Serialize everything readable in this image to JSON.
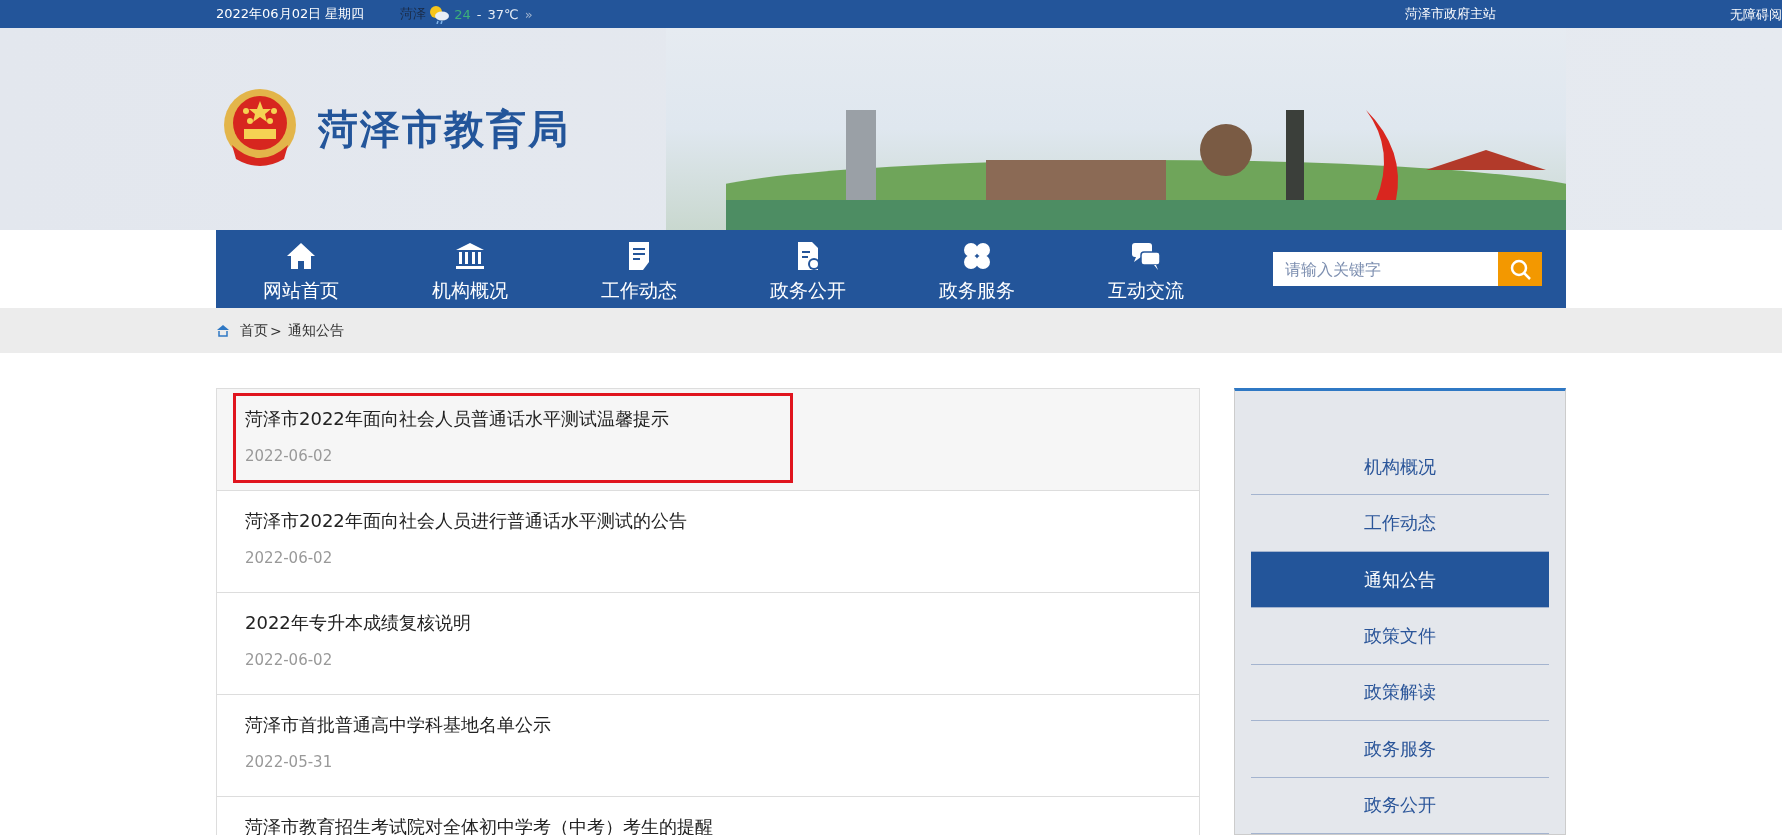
{
  "top_bar": {
    "date": "2022年06月02日 星期四",
    "weather_city": "菏泽",
    "temp_low": "24",
    "temp_sep": "-",
    "temp_high": "37℃",
    "more": "»",
    "links": [
      "菏泽市政府主站",
      "无障碍阅"
    ]
  },
  "header": {
    "title": "菏泽市教育局"
  },
  "nav": {
    "items": [
      {
        "label": "网站首页",
        "kind": "home"
      },
      {
        "label": "机构概况",
        "kind": "bank"
      },
      {
        "label": "工作动态",
        "kind": "doc"
      },
      {
        "label": "政务公开",
        "kind": "file"
      },
      {
        "label": "政务服务",
        "kind": "grid"
      },
      {
        "label": "互动交流",
        "kind": "chat"
      }
    ],
    "search": {
      "placeholder": "请输入关键字"
    }
  },
  "breadcrumb": {
    "home": "首页",
    "sep": ">",
    "current": "通知公告"
  },
  "articles": [
    {
      "title": "菏泽市2022年面向社会人员普通话水平测试温馨提示",
      "date": "2022-06-02",
      "selected": true
    },
    {
      "title": "菏泽市2022年面向社会人员进行普通话水平测试的公告",
      "date": "2022-06-02",
      "selected": false
    },
    {
      "title": "2022年专升本成绩复核说明",
      "date": "2022-06-02",
      "selected": false
    },
    {
      "title": "菏泽市首批普通高中学科基地名单公示",
      "date": "2022-05-31",
      "selected": false
    },
    {
      "title": "菏泽市教育招生考试院对全体初中学考（中考）考生的提醒",
      "selected": false
    }
  ],
  "sidebar": {
    "items": [
      {
        "label": "机构概况",
        "selected": false
      },
      {
        "label": "工作动态",
        "selected": false
      },
      {
        "label": "通知公告",
        "selected": true
      },
      {
        "label": "政策文件",
        "selected": false
      },
      {
        "label": "政策解读",
        "selected": false
      },
      {
        "label": "政务服务",
        "selected": false
      },
      {
        "label": "政务公开",
        "selected": false
      }
    ]
  }
}
